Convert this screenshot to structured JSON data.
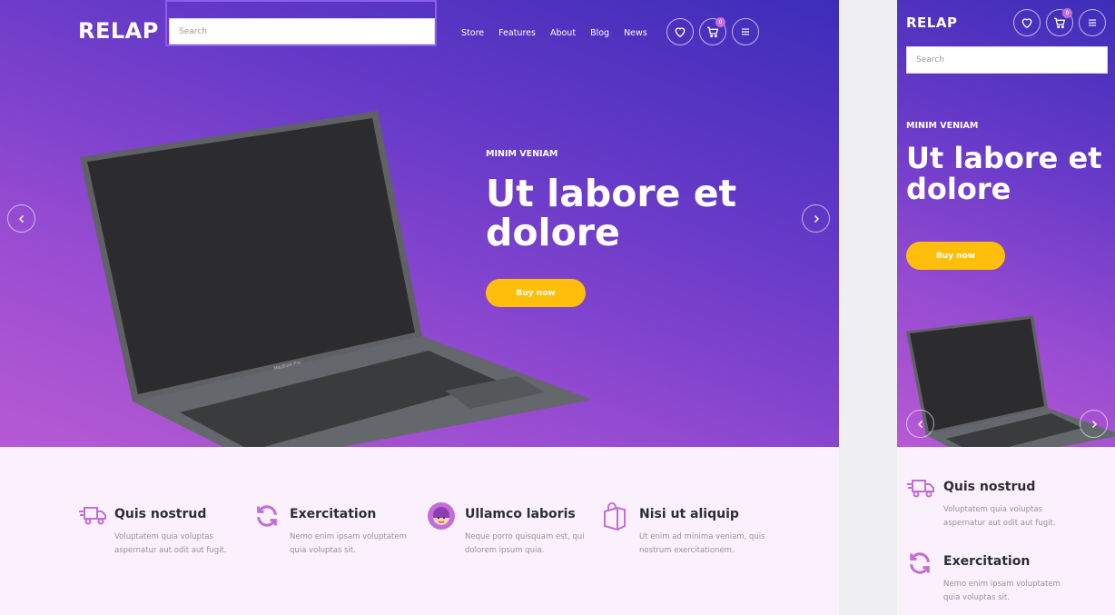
{
  "brand": {
    "logo": "RELAP"
  },
  "search": {
    "placeholder": "Search"
  },
  "nav": {
    "items": [
      "Store",
      "Features",
      "About",
      "Blog",
      "News"
    ]
  },
  "cart": {
    "count": "0"
  },
  "hero": {
    "eyebrow": "MINIM VENIAM",
    "headline": "Ut labore et dolore",
    "cta": "Buy now",
    "laptop_label": "MacBook Pro"
  },
  "features": [
    {
      "icon": "delivery-truck-icon",
      "title": "Quis nostrud",
      "desc": "Voluptatem quia voluptas aspernatur aut odit aut fugit."
    },
    {
      "icon": "refresh-icon",
      "title": "Exercitation",
      "desc": "Nemo enim ipsam voluptatem quia voluptas sit."
    },
    {
      "icon": "support-agent-icon",
      "title": "Ullamco laboris",
      "desc": "Neque porro quisquam est, qui dolorem ipsum quia."
    },
    {
      "icon": "shopping-bag-icon",
      "title": "Nisi ut aliquip",
      "desc": "Ut enim ad minima veniam, quis nostrum exercitationem."
    }
  ],
  "colors": {
    "accent": "#c36ed8",
    "cta": "#ffbe0b",
    "hero_start": "#b65ad3",
    "hero_end": "#3c2db8",
    "feature_bg": "#fbf1fd"
  }
}
